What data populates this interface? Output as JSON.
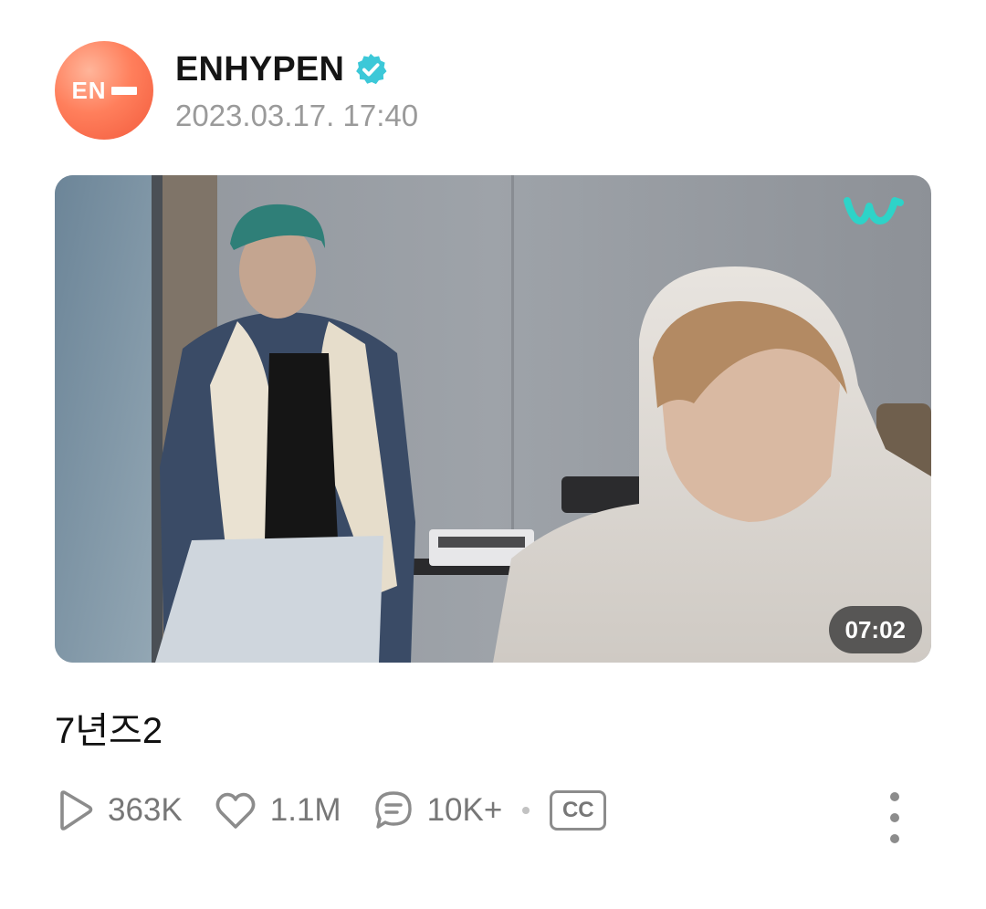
{
  "post": {
    "author": "ENHYPEN",
    "avatar_text": "EN",
    "verified": true,
    "timestamp": "2023.03.17. 17:40",
    "title": "7년즈2"
  },
  "video": {
    "duration": "07:02",
    "brand_logo": "weverse-logo"
  },
  "stats": {
    "plays": "363K",
    "likes": "1.1M",
    "comments": "10K+",
    "captions_label": "CC"
  },
  "icons": {
    "verified": "verified-check-icon",
    "plays": "play-icon",
    "likes": "heart-icon",
    "comments": "comment-bubble-icon",
    "more": "more-vertical-icon"
  },
  "colors": {
    "verified_badge": "#3cc8d8",
    "avatar_brand": "#f26a4c",
    "weverse_logo": "#2ed3c8",
    "muted_text": "#9a9a9a"
  }
}
